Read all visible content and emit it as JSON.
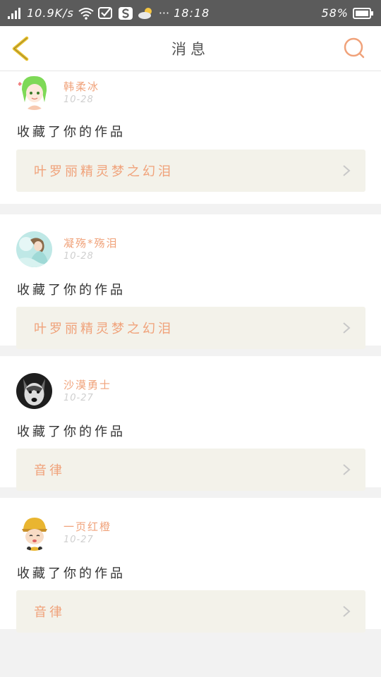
{
  "status_bar": {
    "speed": "10.9K/s",
    "time": "18:18",
    "battery": "58%",
    "dots": "···"
  },
  "header": {
    "title": "消息"
  },
  "notifications": [
    {
      "username": "韩柔冰",
      "date": "10-28",
      "action": "收藏了你的作品",
      "work_title": "叶罗丽精灵梦之幻泪"
    },
    {
      "username": "凝殇*殇泪",
      "date": "10-28",
      "action": "收藏了你的作品",
      "work_title": "叶罗丽精灵梦之幻泪"
    },
    {
      "username": "沙漠勇士",
      "date": "10-27",
      "action": "收藏了你的作品",
      "work_title": "音律"
    },
    {
      "username": "一页红橙",
      "date": "10-27",
      "action": "收藏了你的作品",
      "work_title": "音律"
    }
  ],
  "colors": {
    "accent": "#f0a27a",
    "back_arrow": "#e8c02a",
    "search_ring": "#f0a27a",
    "statusbar_bg": "#5b5b5b"
  }
}
